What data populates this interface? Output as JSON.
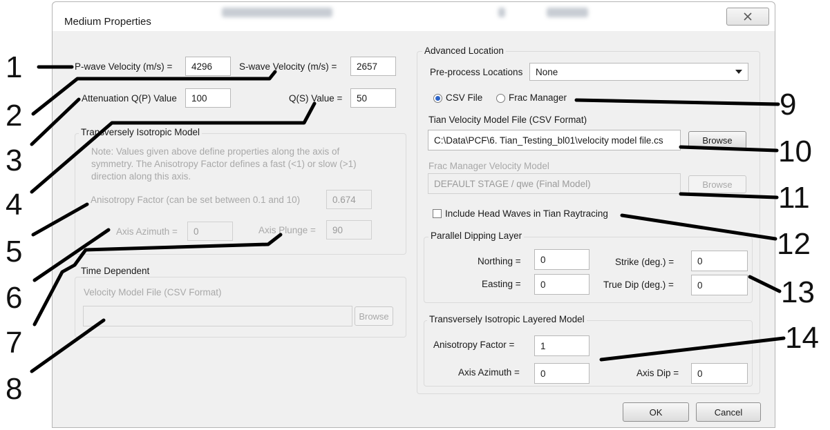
{
  "window": {
    "title": "Medium Properties"
  },
  "basic": {
    "p_wave_label": "P-wave Velocity (m/s) =",
    "p_wave_value": "4296",
    "s_wave_label": "S-wave Velocity (m/s) =",
    "s_wave_value": "2657",
    "atten_label": "Attenuation Q(P) Value",
    "atten_value": "100",
    "qs_label": "Q(S) Value =",
    "qs_value": "50"
  },
  "ti_model": {
    "title": "Transversely Isotropic Model",
    "note_line1": "Note: Values given above define properties along the axis of",
    "note_line2": "symmetry. The Anisotropy Factor defines a fast (<1) or slow (>1)",
    "note_line3": "direction along this axis.",
    "aniso_label": "Anisotropy Factor  (can be set between 0.1 and 10)",
    "aniso_value": "0.674",
    "azimuth_label": "Axis Azimuth =",
    "azimuth_value": "0",
    "plunge_label": "Axis Plunge =",
    "plunge_value": "90"
  },
  "time_dep": {
    "title": "Time Dependent",
    "file_label": "Velocity Model File (CSV Format)",
    "file_value": "",
    "browse_label": "Browse"
  },
  "advanced": {
    "title": "Advanced Location",
    "preprocess_label": "Pre-process Locations",
    "preprocess_value": "None",
    "radio_csv": "CSV File",
    "radio_frac": "Frac Manager",
    "tian_label": "Tian Velocity Model File (CSV Format)",
    "tian_value": "C:\\Data\\PCF\\6. Tian_Testing_bl01\\velocity model file.cs",
    "browse1": "Browse",
    "frac_label": "Frac Manager Velocity Model",
    "frac_value": "DEFAULT STAGE / qwe (Final Model)",
    "browse2": "Browse",
    "head_waves": "Include Head Waves in Tian Raytracing"
  },
  "dipping": {
    "title": "Parallel Dipping Layer",
    "northing_label": "Northing =",
    "northing_value": "0",
    "easting_label": "Easting =",
    "easting_value": "0",
    "strike_label": "Strike (deg.) =",
    "strike_value": "0",
    "dip_label": "True Dip (deg.) =",
    "dip_value": "0"
  },
  "ti_layered": {
    "title": "Transversely Isotropic Layered Model",
    "aniso_label": "Anisotropy Factor =",
    "aniso_value": "1",
    "azimuth_label": "Axis Azimuth =",
    "azimuth_value": "0",
    "dip_label": "Axis Dip =",
    "dip_value": "0"
  },
  "buttons": {
    "ok": "OK",
    "cancel": "Cancel"
  },
  "callouts": [
    "1",
    "2",
    "3",
    "4",
    "5",
    "6",
    "7",
    "8",
    "9",
    "10",
    "11",
    "12",
    "13",
    "14"
  ],
  "colors": {
    "radio_selected": "#2b63c8",
    "disabled_text": "#a8a8a8"
  }
}
